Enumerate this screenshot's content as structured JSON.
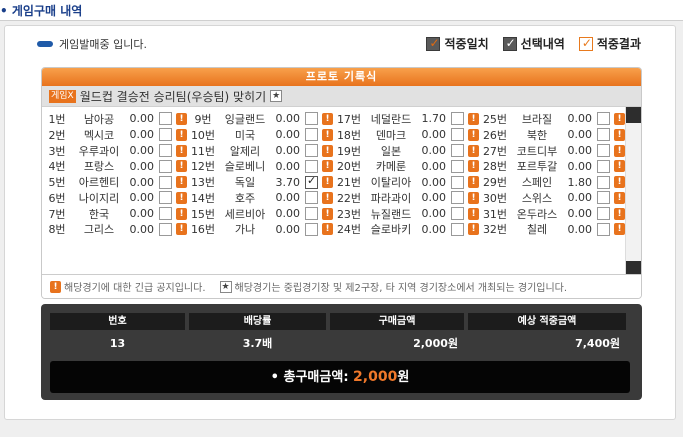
{
  "header": {
    "title": "게임구매 내역"
  },
  "status": {
    "text": "게임발매중 입니다."
  },
  "legend": [
    {
      "label": "적중일치"
    },
    {
      "label": "선택내역"
    },
    {
      "label": "적중결과"
    }
  ],
  "proto": {
    "title": "프로토 기록식",
    "game_badge": "게임X",
    "game_title": "월드컵 결승전 승리팀(우승팀) 맞히기"
  },
  "rows": [
    [
      {
        "no": "1번",
        "team": "남아공",
        "odds": "0.00",
        "checked": false
      },
      {
        "no": "9번",
        "team": "잉글랜드",
        "odds": "0.00",
        "checked": false
      },
      {
        "no": "17번",
        "team": "네덜란드",
        "odds": "1.70",
        "checked": false
      },
      {
        "no": "25번",
        "team": "브라질",
        "odds": "0.00",
        "checked": false
      }
    ],
    [
      {
        "no": "2번",
        "team": "멕시코",
        "odds": "0.00",
        "checked": false
      },
      {
        "no": "10번",
        "team": "미국",
        "odds": "0.00",
        "checked": false
      },
      {
        "no": "18번",
        "team": "덴마크",
        "odds": "0.00",
        "checked": false
      },
      {
        "no": "26번",
        "team": "북한",
        "odds": "0.00",
        "checked": false
      }
    ],
    [
      {
        "no": "3번",
        "team": "우루과이",
        "odds": "0.00",
        "checked": false
      },
      {
        "no": "11번",
        "team": "알제리",
        "odds": "0.00",
        "checked": false
      },
      {
        "no": "19번",
        "team": "일본",
        "odds": "0.00",
        "checked": false
      },
      {
        "no": "27번",
        "team": "코트디부",
        "odds": "0.00",
        "checked": false
      }
    ],
    [
      {
        "no": "4번",
        "team": "프랑스",
        "odds": "0.00",
        "checked": false
      },
      {
        "no": "12번",
        "team": "슬로베니",
        "odds": "0.00",
        "checked": false
      },
      {
        "no": "20번",
        "team": "카메룬",
        "odds": "0.00",
        "checked": false
      },
      {
        "no": "28번",
        "team": "포르투갈",
        "odds": "0.00",
        "checked": false
      }
    ],
    [
      {
        "no": "5번",
        "team": "아르헨티",
        "odds": "0.00",
        "checked": false
      },
      {
        "no": "13번",
        "team": "독일",
        "odds": "3.70",
        "checked": true
      },
      {
        "no": "21번",
        "team": "이탈리아",
        "odds": "0.00",
        "checked": false
      },
      {
        "no": "29번",
        "team": "스페인",
        "odds": "1.80",
        "checked": false
      }
    ],
    [
      {
        "no": "6번",
        "team": "나이지리",
        "odds": "0.00",
        "checked": false
      },
      {
        "no": "14번",
        "team": "호주",
        "odds": "0.00",
        "checked": false
      },
      {
        "no": "22번",
        "team": "파라과이",
        "odds": "0.00",
        "checked": false
      },
      {
        "no": "30번",
        "team": "스위스",
        "odds": "0.00",
        "checked": false
      }
    ],
    [
      {
        "no": "7번",
        "team": "한국",
        "odds": "0.00",
        "checked": false
      },
      {
        "no": "15번",
        "team": "세르비아",
        "odds": "0.00",
        "checked": false
      },
      {
        "no": "23번",
        "team": "뉴질랜드",
        "odds": "0.00",
        "checked": false
      },
      {
        "no": "31번",
        "team": "온두라스",
        "odds": "0.00",
        "checked": false
      }
    ],
    [
      {
        "no": "8번",
        "team": "그리스",
        "odds": "0.00",
        "checked": false
      },
      {
        "no": "16번",
        "team": "가나",
        "odds": "0.00",
        "checked": false
      },
      {
        "no": "24번",
        "team": "슬로바키",
        "odds": "0.00",
        "checked": false
      },
      {
        "no": "32번",
        "team": "칠레",
        "odds": "0.00",
        "checked": false
      }
    ]
  ],
  "notes": {
    "alert_note": "해당경기에 대한 긴급 공지입니다.",
    "star_note": "해당경기는 중립경기장 및 제2구장, 타 지역 경기장소에서 개최되는 경기입니다."
  },
  "summary": {
    "headers": [
      "번호",
      "배당률",
      "구매금액",
      "예상 적중금액"
    ],
    "values": [
      "13",
      "3.7배",
      "2,000원",
      "7,400원"
    ],
    "total_label": "총구매금액:",
    "total_amount": "2,000",
    "total_unit": "원"
  },
  "colors": {
    "accent": "#e8731d",
    "navy": "#1f5aa8"
  }
}
